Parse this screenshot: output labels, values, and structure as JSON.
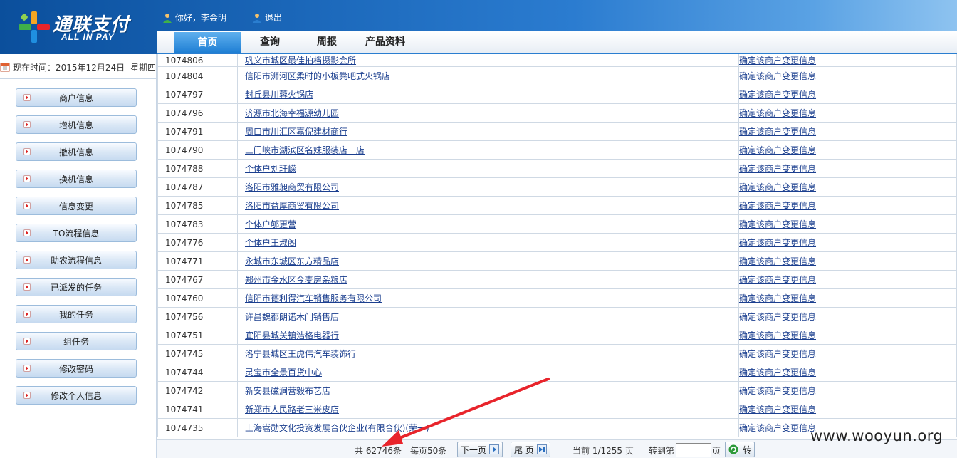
{
  "logo": {
    "cn": "通联支付",
    "en": "ALL IN PAY"
  },
  "user": {
    "greeting": "你好，李会明",
    "logout": "退出"
  },
  "nav": {
    "tabs": [
      "首页",
      "查询",
      "周报",
      "产品资料"
    ]
  },
  "sidebar": {
    "time_label": "现在时间：",
    "date": "2015年12月24日",
    "weekday": "星期四",
    "items": [
      "商户信息",
      "增机信息",
      "撤机信息",
      "换机信息",
      "信息变更",
      "TO流程信息",
      "助农流程信息",
      "已派发的任务",
      "我的任务",
      "组任务",
      "修改密码",
      "修改个人信息"
    ]
  },
  "table": {
    "action_text": "确定该商户变更信息",
    "rows": [
      {
        "id": "1074806",
        "name": "巩义市城区最佳拍档摄影会所"
      },
      {
        "id": "1074804",
        "name": "信阳市浉河区柔时的小板凳吧式火锅店"
      },
      {
        "id": "1074797",
        "name": "封丘县川蓉火锅店"
      },
      {
        "id": "1074796",
        "name": "济源市北海幸福源幼儿园"
      },
      {
        "id": "1074791",
        "name": "周口市川汇区嘉倪建材商行"
      },
      {
        "id": "1074790",
        "name": "三门峡市湖滨区名妹服装店一店"
      },
      {
        "id": "1074788",
        "name": "个体户刘玕嵘"
      },
      {
        "id": "1074787",
        "name": "洛阳市雅昶商贸有限公司"
      },
      {
        "id": "1074785",
        "name": "洛阳市益厚商贸有限公司"
      },
      {
        "id": "1074783",
        "name": "个体户郇更营"
      },
      {
        "id": "1074776",
        "name": "个体户王淑阁"
      },
      {
        "id": "1074771",
        "name": "永城市东城区东方精品店"
      },
      {
        "id": "1074767",
        "name": "郑州市金水区今麦房杂粮店"
      },
      {
        "id": "1074760",
        "name": "信阳市德利得汽车销售服务有限公司"
      },
      {
        "id": "1074756",
        "name": "许昌魏都朗诺木门销售店"
      },
      {
        "id": "1074751",
        "name": "宜阳县城关镇浩格电器行"
      },
      {
        "id": "1074745",
        "name": "洛宁县城区王虎伟汽车装饰行"
      },
      {
        "id": "1074744",
        "name": "灵宝市全景百货中心"
      },
      {
        "id": "1074742",
        "name": "新安县磁涧营毅布艺店"
      },
      {
        "id": "1074741",
        "name": "新郑市人民路老三米皮店"
      },
      {
        "id": "1074735",
        "name": "上海嵩勋文化投资发展合伙企业(有限合伙)(荣一)"
      }
    ]
  },
  "pager": {
    "total": "共 62746条",
    "per_page": "每页50条",
    "next": "下一页",
    "last": "尾 页",
    "current": "当前 1/1255 页",
    "goto_label": "转到第",
    "goto_unit": "页",
    "goto_btn": "转"
  },
  "watermark": "www.wooyun.org",
  "colors": {
    "header_start": "#0b4f9c",
    "header_end": "#8ec3f0",
    "link": "#1b3f8f",
    "annotation_arrow": "#e8242b"
  }
}
